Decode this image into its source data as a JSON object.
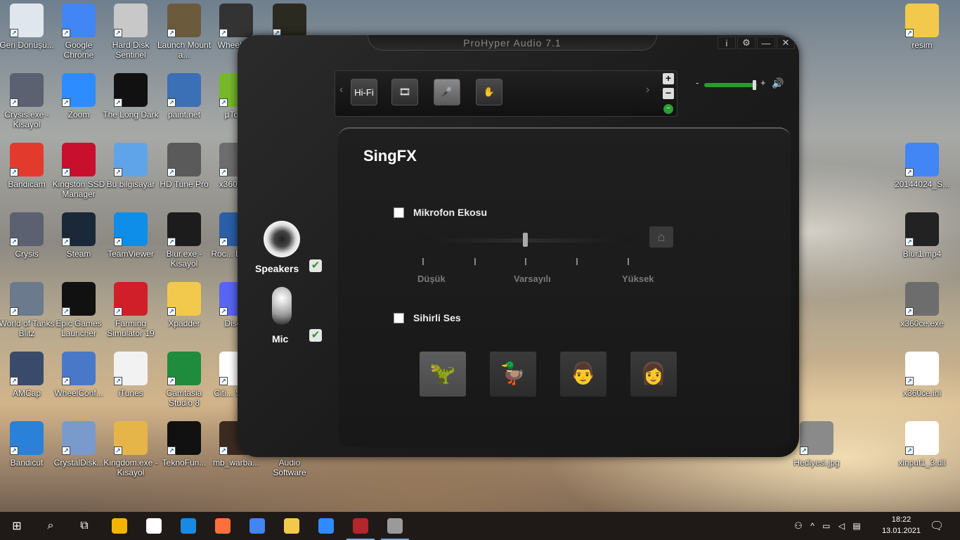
{
  "desktop_icons": [
    {
      "label": "Geri Dönüşü...",
      "icon": "recycle-bin-icon",
      "color": "#dfe6ee"
    },
    {
      "label": "Google Chrome",
      "icon": "chrome-icon",
      "color": "#4285f4"
    },
    {
      "label": "Hard Disk Sentinel",
      "icon": "hdd-icon",
      "color": "#c8c8c8"
    },
    {
      "label": "Launch Mount a...",
      "icon": "game-icon",
      "color": "#6b5a3c"
    },
    {
      "label": "WheelC...",
      "icon": "wheel-icon",
      "color": "#333333"
    },
    {
      "label": "",
      "icon": "star-icon",
      "color": "#2b2a20"
    },
    {
      "label": "Crysis.exe - Kisayol",
      "icon": "crysis-icon",
      "color": "#5b6170"
    },
    {
      "label": "Zoom",
      "icon": "zoom-icon",
      "color": "#2d8cff"
    },
    {
      "label": "The Long Dark",
      "icon": "longdark-icon",
      "color": "#111111"
    },
    {
      "label": "paint.net",
      "icon": "paint-icon",
      "color": "#3b6fb6"
    },
    {
      "label": "µTor...",
      "icon": "utorrent-icon",
      "color": "#76b82a"
    },
    {
      "label": "Bandicam",
      "icon": "bandicam-icon",
      "color": "#e23b2e"
    },
    {
      "label": "Kingston SSD Manager",
      "icon": "kingston-icon",
      "color": "#c8102e"
    },
    {
      "label": "Bu bilgisayar",
      "icon": "computer-icon",
      "color": "#5fa4e8"
    },
    {
      "label": "HD Tune Pro",
      "icon": "hdtune-icon",
      "color": "#5a5a5a"
    },
    {
      "label": "x360ce...",
      "icon": "gamepad-icon",
      "color": "#6d6d6d"
    },
    {
      "label": "Crysis",
      "icon": "crysis-icon",
      "color": "#5b6170"
    },
    {
      "label": "Steam",
      "icon": "steam-icon",
      "color": "#1b2838"
    },
    {
      "label": "TeamViewer",
      "icon": "teamviewer-icon",
      "color": "#0e8ee9"
    },
    {
      "label": "Blur.exe - Kisayol",
      "icon": "blur-icon",
      "color": "#1c1c1c"
    },
    {
      "label": "Roc... Leag...",
      "icon": "rocket-icon",
      "color": "#2b5fa8"
    },
    {
      "label": "World of Tanks Blitz",
      "icon": "tanks-icon",
      "color": "#6b7a8c"
    },
    {
      "label": "Epic Games Launcher",
      "icon": "epic-icon",
      "color": "#111111"
    },
    {
      "label": "Farming Simulator 19",
      "icon": "farming-icon",
      "color": "#d11f2a"
    },
    {
      "label": "Xpadder",
      "icon": "folder-icon",
      "color": "#f2c94c"
    },
    {
      "label": "Disc...",
      "icon": "discord-icon",
      "color": "#5865f2"
    },
    {
      "label": "AMCap",
      "icon": "camera-icon",
      "color": "#3a4a6a"
    },
    {
      "label": "WheelConf...",
      "icon": "wheelconf-icon",
      "color": "#4a78c8"
    },
    {
      "label": "iTunes",
      "icon": "itunes-icon",
      "color": "#f2f2f2"
    },
    {
      "label": "Camtasia Studio 8",
      "icon": "camtasia-icon",
      "color": "#1f8b3c"
    },
    {
      "label": "Citi... Skyl...",
      "icon": "file-icon",
      "color": "#ffffff"
    },
    {
      "label": "Bandicut",
      "icon": "bandicut-icon",
      "color": "#2b80d8"
    },
    {
      "label": "CrystalDisk...",
      "icon": "crystaldisk-icon",
      "color": "#7a9acb"
    },
    {
      "label": "Kingdom.exe - Kisayol",
      "icon": "crown-icon",
      "color": "#e6b54a"
    },
    {
      "label": "TeknoFun...",
      "icon": "teknofun-icon",
      "color": "#111111"
    },
    {
      "label": "mb_warba...",
      "icon": "warband-icon",
      "color": "#3a2a22"
    },
    {
      "label": "Audio Software",
      "icon": "audio-icon",
      "color": "#555555"
    },
    {
      "label": "resim",
      "icon": "folder-icon",
      "color": "#f2c94c"
    },
    {
      "label": "20144024_S...",
      "icon": "chrome-icon",
      "color": "#4285f4"
    },
    {
      "label": "Blur1.mp4",
      "icon": "video-icon",
      "color": "#222222"
    },
    {
      "label": "x360ce.exe",
      "icon": "gamepad-icon",
      "color": "#6d6d6d"
    },
    {
      "label": "x360ce.ini",
      "icon": "settings-file-icon",
      "color": "#ffffff"
    },
    {
      "label": "Hediyesi.jpg",
      "icon": "image-icon",
      "color": "#8a8a8a"
    },
    {
      "label": "xinput1_3.dll",
      "icon": "dll-icon",
      "color": "#ffffff"
    }
  ],
  "app": {
    "title": "ProHyper Audio 7.1",
    "info_btn": "i",
    "settings_btn": "⚙",
    "minimize_btn": "—",
    "close_btn": "✕",
    "modes": [
      {
        "label": "Hi-Fi",
        "icon": "hifi-icon"
      },
      {
        "label": "🎞",
        "icon": "movie-reel-icon"
      },
      {
        "label": "🎤",
        "icon": "microphone-mode-icon"
      },
      {
        "label": "✋",
        "icon": "hand-icon"
      }
    ],
    "plus": "+",
    "minus": "−",
    "volume": {
      "minus": "-",
      "plus": "+",
      "level": 0.95,
      "speaker": "🔊"
    },
    "devices": [
      {
        "label": "Speakers",
        "checked": "✔"
      },
      {
        "label": "Mic",
        "checked": "✔"
      }
    ],
    "panel": {
      "title": "SingFX",
      "echo_label": "Mikrofon Ekosu",
      "echo_level": 0.5,
      "tick_labels": [
        "Düşük",
        "Varsayılı",
        "Yüksek"
      ],
      "magic_label": "Sihirli Ses",
      "voices": [
        {
          "icon": "dinosaur-icon",
          "glyph": "🦖"
        },
        {
          "icon": "duck-icon",
          "glyph": "🦆"
        },
        {
          "icon": "man-icon",
          "glyph": "👨"
        },
        {
          "icon": "woman-icon",
          "glyph": "👩"
        }
      ],
      "home_glyph": "⌂"
    }
  },
  "taskbar": {
    "start": "⊞",
    "search": "⌕",
    "task_view": "⧉",
    "items": [
      "store-icon",
      "mail-icon",
      "edge-icon",
      "firefox-icon",
      "chrome-icon",
      "explorer-icon",
      "zoom-icon",
      "winrar-icon",
      "prohyper-icon"
    ],
    "time": "18:22",
    "date": "13.01.2021",
    "notif": "🗨"
  }
}
